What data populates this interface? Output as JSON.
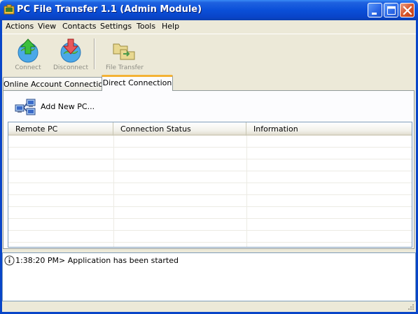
{
  "window": {
    "title": "PC File Transfer 1.1 (Admin Module)"
  },
  "menu": {
    "items": [
      {
        "label": "Actions"
      },
      {
        "label": "View"
      },
      {
        "label": "Contacts"
      },
      {
        "label": "Settings"
      },
      {
        "label": "Tools"
      },
      {
        "label": "Help"
      }
    ]
  },
  "toolbar": {
    "connect_label": "Connect",
    "disconnect_label": "Disconnect",
    "file_transfer_label": "File Transfer",
    "disabled_text_color": "#8d8d84"
  },
  "tabs": [
    {
      "label": "Online Account Connection",
      "active": false
    },
    {
      "label": "Direct Connection",
      "active": true
    }
  ],
  "panel": {
    "add_new_pc_label": "Add New PC..."
  },
  "list": {
    "columns": [
      "Remote PC",
      "Connection Status",
      "Information"
    ],
    "rows": []
  },
  "log": {
    "entries": [
      {
        "icon": "info-icon",
        "text": "1:38:20 PM> Application has been started"
      }
    ]
  },
  "colors": {
    "titlebar_blue": "#0a4fd8",
    "tab_highlight": "#f4b235",
    "close_red": "#d8582e"
  }
}
